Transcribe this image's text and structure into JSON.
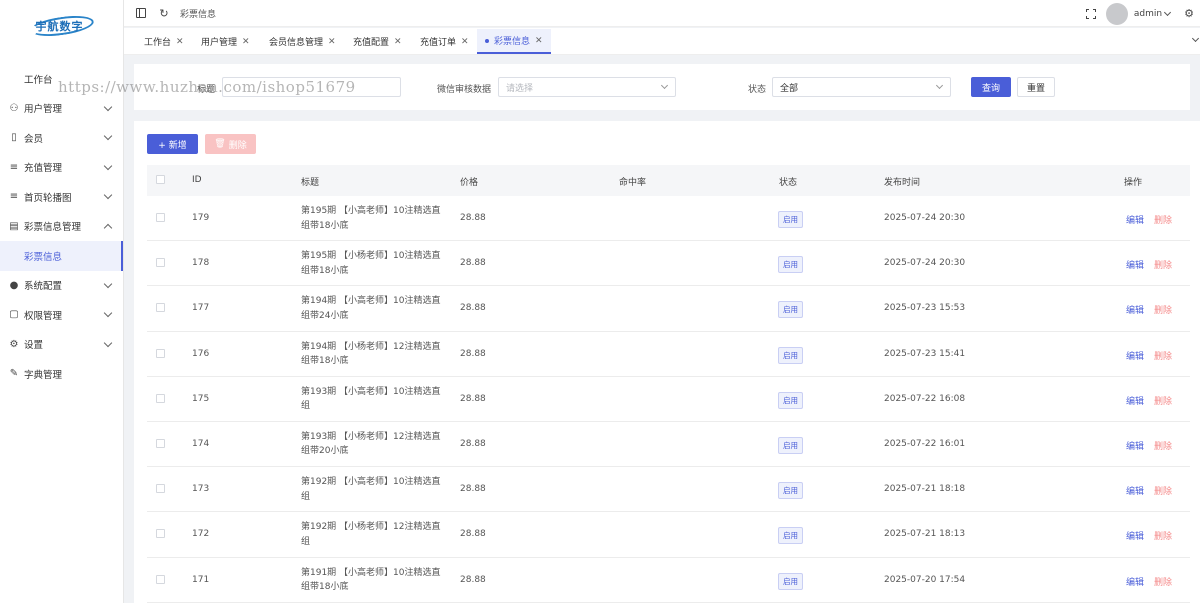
{
  "brand": {
    "logo_text": "宇航数字"
  },
  "sidebar": {
    "items": [
      {
        "label": "工作台",
        "icon": "",
        "type": "plain"
      },
      {
        "label": "用户管理",
        "icon": "user-icon",
        "type": "group"
      },
      {
        "label": "会员",
        "icon": "badge-icon",
        "type": "group"
      },
      {
        "label": "充值管理",
        "icon": "list-icon",
        "type": "group"
      },
      {
        "label": "首页轮播图",
        "icon": "list-icon",
        "type": "group"
      },
      {
        "label": "彩票信息管理",
        "icon": "calendar-icon",
        "type": "group-open"
      },
      {
        "label": "彩票信息",
        "icon": "",
        "type": "sub-active"
      },
      {
        "label": "系统配置",
        "icon": "check-circle-icon",
        "type": "group"
      },
      {
        "label": "权限管理",
        "icon": "lock-icon",
        "type": "group"
      },
      {
        "label": "设置",
        "icon": "gear-icon",
        "type": "group"
      },
      {
        "label": "字典管理",
        "icon": "edit-icon",
        "type": "plain-icon"
      }
    ]
  },
  "header": {
    "breadcrumb": "彩票信息",
    "user": "admin"
  },
  "tabs": [
    {
      "label": "工作台"
    },
    {
      "label": "用户管理"
    },
    {
      "label": "会员信息管理"
    },
    {
      "label": "充值配置"
    },
    {
      "label": "充值订单"
    },
    {
      "label": "彩票信息"
    }
  ],
  "search": {
    "title_label": "标题",
    "title_value": "",
    "wechat_label": "微信审核数据",
    "wechat_placeholder": "请选择",
    "status_label": "状态",
    "status_value": "全部",
    "query_button": "查询",
    "reset_button": "重置"
  },
  "toolbar": {
    "add_button": "+ 新增",
    "delete_button": "删除"
  },
  "table": {
    "columns": [
      "ID",
      "标题",
      "价格",
      "命中率",
      "状态",
      "发布时间",
      "操作"
    ],
    "edit_label": "编辑",
    "delete_label": "删除",
    "rows": [
      {
        "id": "179",
        "title": "第195期 【小高老师】10注精选直组带18小底",
        "price": "28.88",
        "hit": "",
        "status": "启用",
        "time": "2025-07-24 20:30"
      },
      {
        "id": "178",
        "title": "第195期 【小杨老师】10注精选直组带18小底",
        "price": "28.88",
        "hit": "",
        "status": "启用",
        "time": "2025-07-24 20:30"
      },
      {
        "id": "177",
        "title": "第194期 【小高老师】10注精选直组带24小底",
        "price": "28.88",
        "hit": "",
        "status": "启用",
        "time": "2025-07-23 15:53"
      },
      {
        "id": "176",
        "title": "第194期 【小杨老师】12注精选直组带18小底",
        "price": "28.88",
        "hit": "",
        "status": "启用",
        "time": "2025-07-23 15:41"
      },
      {
        "id": "175",
        "title": "第193期 【小高老师】10注精选直组",
        "price": "28.88",
        "hit": "",
        "status": "启用",
        "time": "2025-07-22 16:08"
      },
      {
        "id": "174",
        "title": "第193期 【小杨老师】12注精选直组带20小底",
        "price": "28.88",
        "hit": "",
        "status": "启用",
        "time": "2025-07-22 16:01"
      },
      {
        "id": "173",
        "title": "第192期 【小高老师】10注精选直组",
        "price": "28.88",
        "hit": "",
        "status": "启用",
        "time": "2025-07-21 18:18"
      },
      {
        "id": "172",
        "title": "第192期 【小杨老师】12注精选直组",
        "price": "28.88",
        "hit": "",
        "status": "启用",
        "time": "2025-07-21 18:13"
      },
      {
        "id": "171",
        "title": "第191期 【小高老师】10注精选直组带18小底",
        "price": "28.88",
        "hit": "",
        "status": "启用",
        "time": "2025-07-20 17:54"
      }
    ]
  },
  "watermark": "https://www.huzhan.com/ishop51679",
  "colors": {
    "primary": "#4a5ed8",
    "danger": "#f48888",
    "danger_disabled": "#f9c3c3"
  }
}
